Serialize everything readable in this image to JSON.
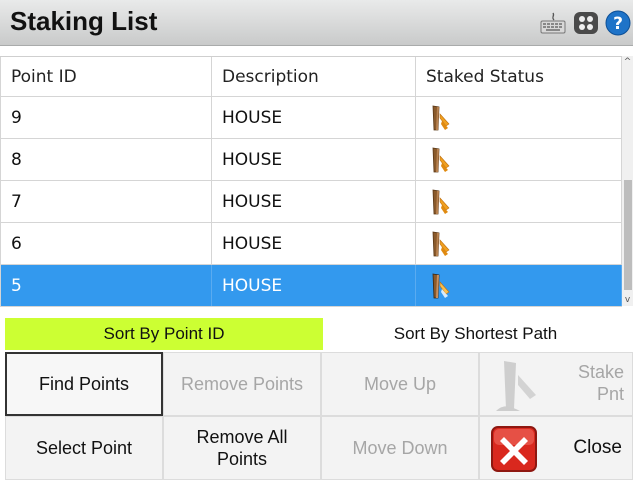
{
  "window": {
    "title": "Staking List"
  },
  "table": {
    "headers": [
      "Point ID",
      "Description",
      "Staked Status"
    ],
    "rows": [
      {
        "id": "9",
        "description": "HOUSE",
        "status": "staked"
      },
      {
        "id": "8",
        "description": "HOUSE",
        "status": "staked"
      },
      {
        "id": "7",
        "description": "HOUSE",
        "status": "staked"
      },
      {
        "id": "6",
        "description": "HOUSE",
        "status": "staked"
      },
      {
        "id": "5",
        "description": "HOUSE",
        "status": "staked",
        "selected": true
      }
    ]
  },
  "sort": {
    "by_point_id": "Sort By Point ID",
    "by_shortest_path": "Sort By Shortest Path",
    "active": "by_point_id"
  },
  "buttons": {
    "find_points": "Find Points",
    "remove_points": "Remove Points",
    "move_up": "Move Up",
    "stake_pnt": "Stake Pnt",
    "select_point": "Select Point",
    "remove_all_points": "Remove All Points",
    "move_down": "Move Down",
    "close": "Close"
  },
  "icons": {
    "keyboard": "keyboard-icon",
    "grid": "grid-icon",
    "help": "help-icon",
    "staked": "stake-hammer-icon",
    "close": "close-x-icon"
  },
  "colors": {
    "selected_row": "#3399ee",
    "active_sort": "#ccff33",
    "close_red": "#d9281e"
  }
}
